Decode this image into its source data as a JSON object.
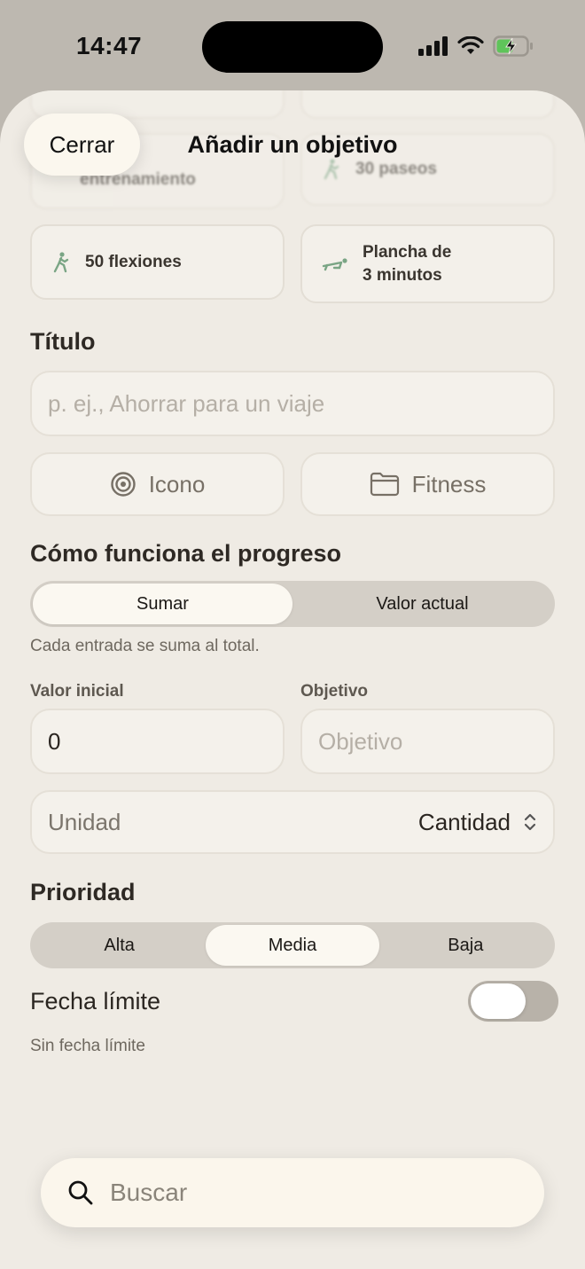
{
  "status_bar": {
    "time": "14:47"
  },
  "header": {
    "title": "Añadir un objetivo",
    "close_label": "Cerrar"
  },
  "templates": [
    {
      "label": "entrenamiento",
      "icon": "timer-icon"
    },
    {
      "label": "30 paseos",
      "icon": "walk-icon"
    },
    {
      "label": "50 flexiones",
      "icon": "pushup-icon"
    },
    {
      "label_line1": "Plancha de",
      "label_line2": "3 minutos",
      "icon": "plank-icon"
    }
  ],
  "title_section": {
    "heading": "Título",
    "placeholder": "p. ej., Ahorrar para un viaje",
    "icon_button": "Icono",
    "category_button": "Fitness"
  },
  "progress": {
    "heading": "Cómo funciona el progreso",
    "options": [
      "Sumar",
      "Valor actual"
    ],
    "selected": "Sumar",
    "caption": "Cada entrada se suma al total."
  },
  "values": {
    "initial_label": "Valor inicial",
    "initial_value": "0",
    "target_label": "Objetivo",
    "target_placeholder": "Objetivo",
    "unit_label": "Unidad",
    "unit_value": "Cantidad"
  },
  "priority": {
    "heading": "Prioridad",
    "options": [
      "Alta",
      "Media",
      "Baja"
    ],
    "selected": "Media"
  },
  "deadline": {
    "label": "Fecha límite",
    "caption": "Sin fecha límite",
    "enabled": false
  },
  "search": {
    "placeholder": "Buscar"
  },
  "colors": {
    "accent_green": "#7aa585",
    "sheet_bg": "#efebe4"
  }
}
